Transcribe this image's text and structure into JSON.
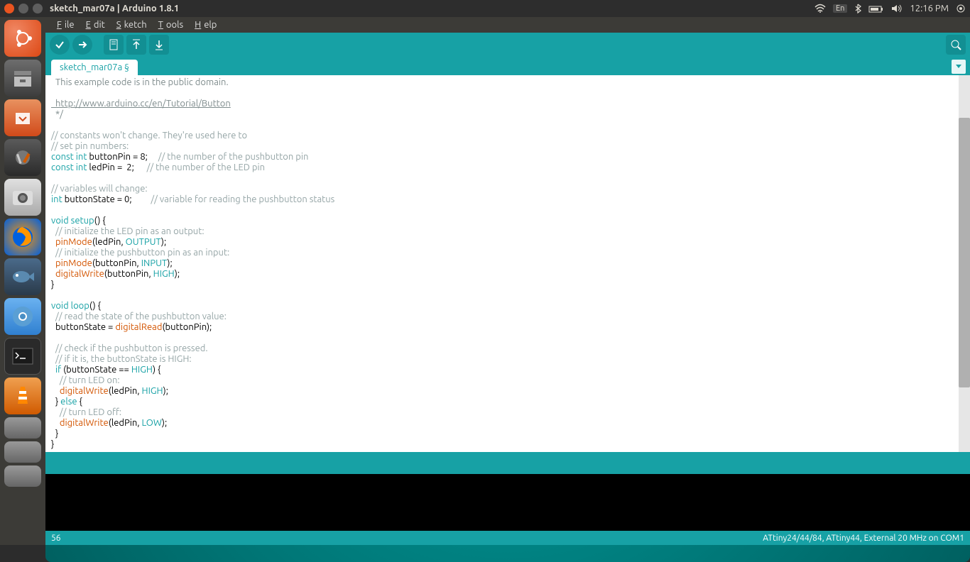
{
  "ubuntu_bar": {
    "title": "sketch_mar07a | Arduino 1.8.1",
    "time": "12:16 PM",
    "lang": "En"
  },
  "menu": {
    "file": "File",
    "edit": "Edit",
    "sketch": "Sketch",
    "tools": "Tools",
    "help": "Help"
  },
  "tab": {
    "name": "sketch_mar07a §"
  },
  "code": {
    "line1": "  This example code is in the public domain.",
    "blank1": "",
    "link": "  http://www.arduino.cc/en/Tutorial/Button",
    "endcomment": "  */",
    "blank2": "",
    "c1": "// constants won't change. They're used here to",
    "c2": "// set pin numbers:",
    "const1a": "const int",
    "const1b": " buttonPin = 8;     ",
    "const1c": "// the number of the pushbutton pin",
    "const2a": "const int",
    "const2b": " ledPin =  2;      ",
    "const2c": "// the number of the LED pin",
    "blank3": "",
    "c3": "// variables will change:",
    "var1a": "int",
    "var1b": " buttonState = 0;         ",
    "var1c": "// variable for reading the pushbutton status",
    "blank4": "",
    "setup1a": "void",
    "setup1b": " ",
    "setup1c": "setup",
    "setup1d": "() {",
    "setup2": "  // initialize the LED pin as an output:",
    "setup3a": "  ",
    "setup3b": "pinMode",
    "setup3c": "(ledPin, ",
    "setup3d": "OUTPUT",
    "setup3e": ");",
    "setup4": "  // initialize the pushbutton pin as an input:",
    "setup5a": "  ",
    "setup5b": "pinMode",
    "setup5c": "(buttonPin, ",
    "setup5d": "INPUT",
    "setup5e": ");",
    "setup6a": "  ",
    "setup6b": "digitalWrite",
    "setup6c": "(buttonPin, ",
    "setup6d": "HIGH",
    "setup6e": ");",
    "setup7": "}",
    "blank5": "",
    "loop1a": "void",
    "loop1b": " ",
    "loop1c": "loop",
    "loop1d": "() {",
    "loop2": "  // read the state of the pushbutton value:",
    "loop3a": "  buttonState = ",
    "loop3b": "digitalRead",
    "loop3c": "(buttonPin);",
    "blank6": "",
    "loop4": "  // check if the pushbutton is pressed.",
    "loop5": "  // if it is, the buttonState is HIGH:",
    "loop6a": "  ",
    "loop6b": "if",
    "loop6c": " (buttonState == ",
    "loop6d": "HIGH",
    "loop6e": ") {",
    "loop7": "    // turn LED on:",
    "loop8a": "    ",
    "loop8b": "digitalWrite",
    "loop8c": "(ledPin, ",
    "loop8d": "HIGH",
    "loop8e": ");",
    "loop9a": "  } ",
    "loop9b": "else",
    "loop9c": " {",
    "loop10": "    // turn LED off:",
    "loop11a": "    ",
    "loop11b": "digitalWrite",
    "loop11c": "(ledPin, ",
    "loop11d": "LOW",
    "loop11e": ");",
    "loop12": "  }",
    "loop13": "}"
  },
  "status": {
    "line": "56",
    "board": "ATtiny24/44/84, ATtiny44, External 20 MHz on COM1"
  }
}
